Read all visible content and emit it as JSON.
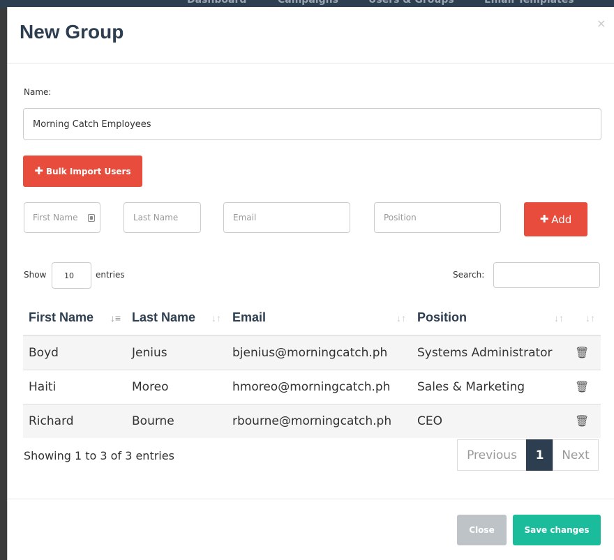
{
  "background_nav": {
    "items": [
      "Dashboard",
      "Campaigns",
      "Users & Groups",
      "Email Templates"
    ]
  },
  "modal": {
    "title": "New Group",
    "close_symbol": "×",
    "name_label": "Name:",
    "name_value": "Morning Catch Employees",
    "bulk_import_label": "Bulk Import Users",
    "inputs": {
      "first_name_placeholder": "First Name",
      "last_name_placeholder": "Last Name",
      "email_placeholder": "Email",
      "position_placeholder": "Position"
    },
    "add_label": "Add",
    "show_label": "Show",
    "entries_value": "10",
    "entries_label": "entries",
    "search_label": "Search:",
    "search_value": "",
    "columns": [
      "First Name",
      "Last Name",
      "Email",
      "Position"
    ],
    "rows": [
      {
        "first": "Boyd",
        "last": "Jenius",
        "email": "bjenius@morningcatch.ph",
        "position": "Systems Administrator"
      },
      {
        "first": "Haiti",
        "last": "Moreo",
        "email": "hmoreo@morningcatch.ph",
        "position": "Sales & Marketing"
      },
      {
        "first": "Richard",
        "last": "Bourne",
        "email": "rbourne@morningcatch.ph",
        "position": "CEO"
      }
    ],
    "info_text": "Showing 1 to 3 of 3 entries",
    "pagination": {
      "previous": "Previous",
      "current": "1",
      "next": "Next"
    },
    "footer": {
      "close_label": "Close",
      "save_label": "Save changes"
    }
  },
  "colors": {
    "accent_red": "#e74c3c",
    "accent_green": "#1abc9c",
    "title_navy": "#2c3e50",
    "close_grey": "#bdc3c7"
  }
}
